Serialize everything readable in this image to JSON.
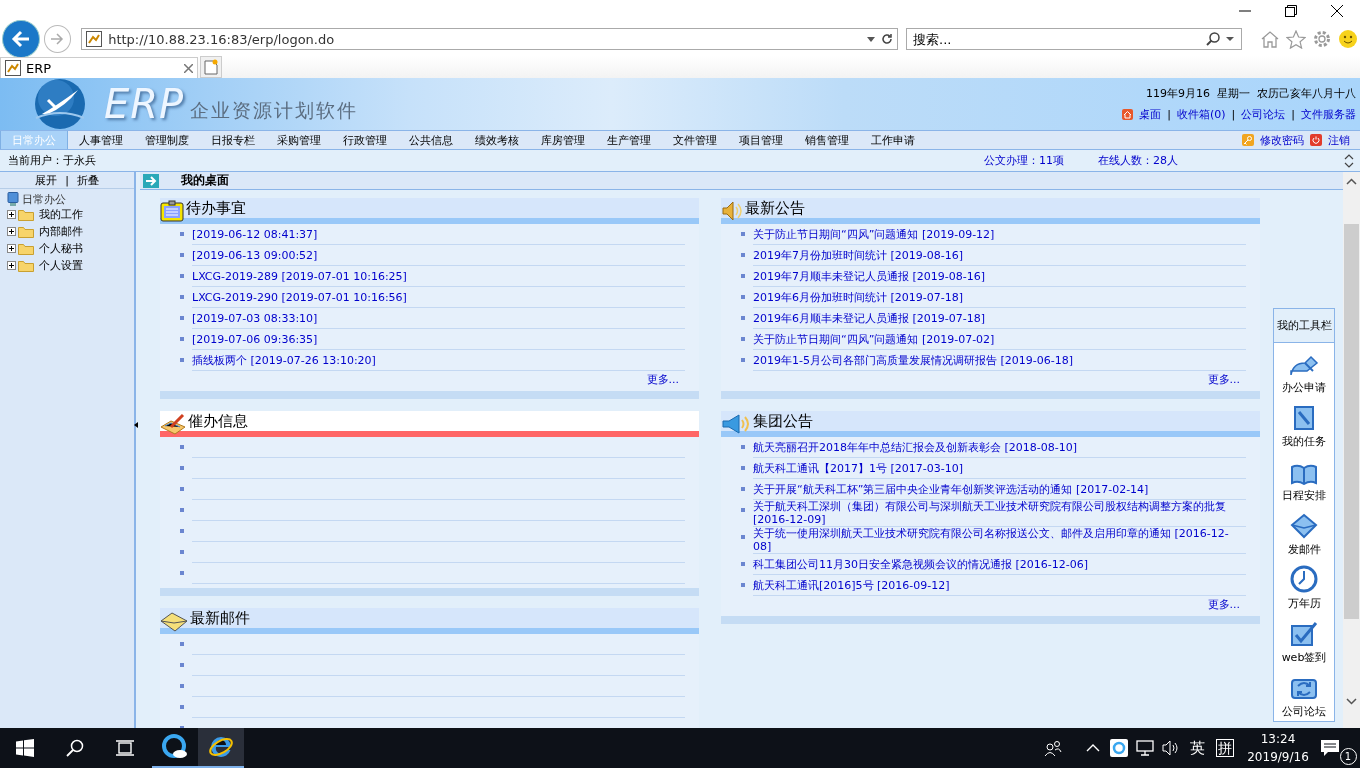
{
  "browser": {
    "address": "http://10.88.23.16:83/erp/logon.do",
    "search": {
      "placeholder": "搜索..."
    },
    "tabs": [
      {
        "label": "ERP",
        "selected": true
      }
    ]
  },
  "banner": {
    "logo": "ERP",
    "subtitle": "企业资源计划软件",
    "date": "119年9月16  星期一  农历己亥年八月十八",
    "separator": "|",
    "links": [
      "桌面",
      "收件箱(0)",
      "公司论坛",
      "文件服务器"
    ]
  },
  "nav": {
    "items": [
      {
        "label": "日常办公",
        "selected": true
      },
      {
        "label": "人事管理",
        "selected": false
      },
      {
        "label": "管理制度",
        "selected": false
      },
      {
        "label": "日报专栏",
        "selected": false
      },
      {
        "label": "采购管理",
        "selected": false
      },
      {
        "label": "行政管理",
        "selected": false
      },
      {
        "label": "公共信息",
        "selected": false
      },
      {
        "label": "绩效考核",
        "selected": false
      },
      {
        "label": "库房管理",
        "selected": false
      },
      {
        "label": "生产管理",
        "selected": false
      },
      {
        "label": "文件管理",
        "selected": false
      },
      {
        "label": "项目管理",
        "selected": false
      },
      {
        "label": "销售管理",
        "selected": false
      },
      {
        "label": "工作申请",
        "selected": false
      }
    ],
    "actions": [
      {
        "label": "修改密码",
        "kind": "key"
      },
      {
        "label": "注销",
        "kind": "power"
      }
    ]
  },
  "status": {
    "user": "当前用户：于永兵",
    "documents": "公文办理：11项",
    "online": "在线人数：28人"
  },
  "sidebar": {
    "controls": [
      "展开",
      "折叠"
    ],
    "separator": "|",
    "tree": {
      "label": "日常办公",
      "children": [
        {
          "label": "我的工作",
          "expanded": false
        },
        {
          "label": "内部邮件",
          "expanded": false
        },
        {
          "label": "个人秘书",
          "expanded": false
        },
        {
          "label": "个人设置",
          "expanded": false
        }
      ]
    }
  },
  "desktop": {
    "title": "我的桌面",
    "columns": [
      [
        {
          "title": "待办事宜",
          "alert": false,
          "more": "更多...",
          "items": [
            "[2019-06-12 08:41:37]",
            "[2019-06-13 09:00:52]",
            "LXCG-2019-289 [2019-07-01 10:16:25]",
            "LXCG-2019-290 [2019-07-01 10:16:56]",
            "[2019-07-03 08:33:10]",
            "[2019-07-06 09:36:35]",
            "插线板两个 [2019-07-26 13:10:20]"
          ]
        },
        {
          "title": "催办信息",
          "alert": true
        },
        {
          "title": "最新邮件",
          "alert": false
        }
      ],
      [
        {
          "title": "最新公告",
          "alert": false,
          "more": "更多...",
          "items": [
            "关于防止节日期间“四风”问题通知 [2019-09-12]",
            "2019年7月份加班时间统计 [2019-08-16]",
            "2019年7月顺丰未登记人员通报 [2019-08-16]",
            "2019年6月份加班时间统计 [2019-07-18]",
            "2019年6月顺丰未登记人员通报 [2019-07-18]",
            "关于防止节日期间“四风”问题通知 [2019-07-02]",
            "2019年1-5月公司各部门高质量发展情况调研报告 [2019-06-18]"
          ]
        },
        {
          "title": "集团公告",
          "alert": false,
          "more": "更多...",
          "items": [
            "航天亮丽召开2018年年中总结汇报会及创新表彰会 [2018-08-10]",
            "航天科工通讯【2017】1号 [2017-03-10]",
            "关于开展“航天科工杯”第三届中央企业青年创新奖评选活动的通知 [2017-02-14]",
            "关于航天科工深圳（集团）有限公司与深圳航天工业技术研究院有限公司股权结构调整方案的批复 [2016-12-09]",
            "关于统一使用深圳航天工业技术研究院有限公司名称报送公文、邮件及启用印章的通知 [2016-12-08]",
            "科工集团公司11月30日安全紧急视频会议的情况通报 [2016-12-06]",
            "航天科工通讯[2016]5号 [2016-09-12]"
          ]
        }
      ]
    ]
  },
  "toolbar": {
    "title": "我的工具栏",
    "items": [
      "办公申请",
      "我的任务",
      "日程安排",
      "发邮件",
      "万年历",
      "web签到",
      "公司论坛"
    ]
  },
  "taskbar": {
    "input_language": "英",
    "ime": "拼",
    "time": "13:24",
    "date": "2019/9/16",
    "notifications": "1"
  }
}
